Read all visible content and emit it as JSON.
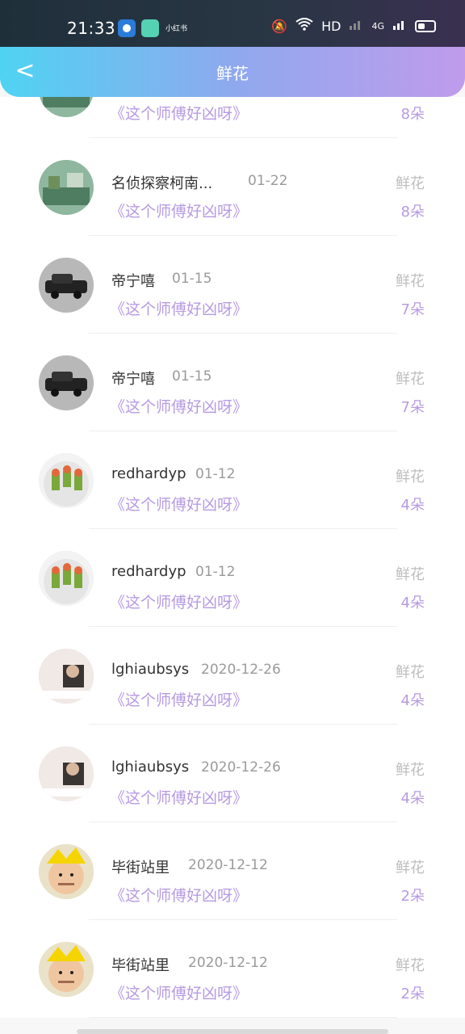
{
  "status_bar": {
    "time": "21:33",
    "small_app_text": "小红书",
    "right_items": [
      "HD",
      "4G"
    ],
    "icons": [
      "app-blue-icon",
      "app-green-icon",
      "mute-bell-icon",
      "wifi-icon",
      "signal-icon",
      "battery-icon"
    ]
  },
  "header": {
    "title": "鲜花",
    "back_icon": "chevron-left-icon",
    "back_glyph": "<"
  },
  "colors": {
    "accent_start": "#4fd3f3",
    "accent_end": "#c09bec",
    "note": "#b79be3"
  },
  "list": [
    {
      "name": "",
      "date": "",
      "label": "",
      "note": "《这个师傅好凶呀》",
      "count": "8朵",
      "avatar": "garden"
    },
    {
      "name": "名侦探察柯南...",
      "date": "01-22",
      "label": "鲜花",
      "note": "《这个师傅好凶呀》",
      "count": "8朵",
      "avatar": "garden"
    },
    {
      "name": "帝宁嘻",
      "date": "01-15",
      "label": "鲜花",
      "note": "《这个师傅好凶呀》",
      "count": "7朵",
      "avatar": "car"
    },
    {
      "name": "帝宁嘻",
      "date": "01-15",
      "label": "鲜花",
      "note": "《这个师傅好凶呀》",
      "count": "7朵",
      "avatar": "car"
    },
    {
      "name": "redhardyp",
      "date": "01-12",
      "label": "鲜花",
      "note": "《这个师傅好凶呀》",
      "count": "4朵",
      "avatar": "food"
    },
    {
      "name": "redhardyp",
      "date": "01-12",
      "label": "鲜花",
      "note": "《这个师傅好凶呀》",
      "count": "4朵",
      "avatar": "food"
    },
    {
      "name": "lghiaubsys",
      "date": "2020-12-26",
      "label": "鲜花",
      "note": "《这个师傅好凶呀》",
      "count": "4朵",
      "avatar": "person"
    },
    {
      "name": "lghiaubsys",
      "date": "2020-12-26",
      "label": "鲜花",
      "note": "《这个师傅好凶呀》",
      "count": "4朵",
      "avatar": "person"
    },
    {
      "name": "毕街站里",
      "date": "2020-12-12",
      "label": "鲜花",
      "note": "《这个师傅好凶呀》",
      "count": "2朵",
      "avatar": "cartoon"
    },
    {
      "name": "毕街站里",
      "date": "2020-12-12",
      "label": "鲜花",
      "note": "《这个师傅好凶呀》",
      "count": "2朵",
      "avatar": "cartoon"
    }
  ]
}
